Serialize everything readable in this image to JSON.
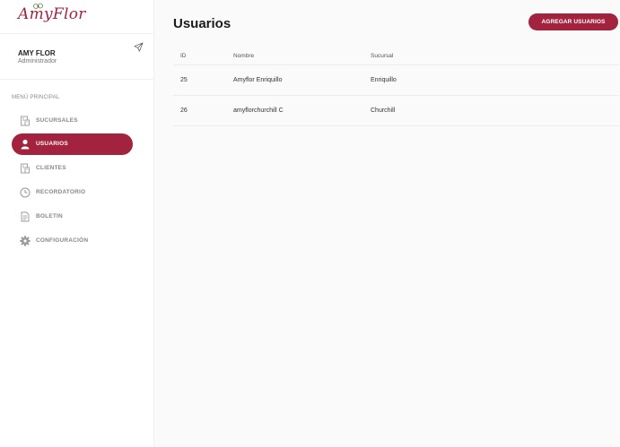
{
  "app": {
    "logo_text": "AmyFlor"
  },
  "user": {
    "name": "AMY FLOR",
    "role": "Administrador"
  },
  "sidebar": {
    "heading": "MENÚ PRINCIPAL",
    "items": [
      {
        "label": "SUCURSALES",
        "icon": "building-icon",
        "active": false
      },
      {
        "label": "USUARIOS",
        "icon": "user-icon",
        "active": true
      },
      {
        "label": "CLIENTES",
        "icon": "building-icon",
        "active": false
      },
      {
        "label": "RECORDATORIO",
        "icon": "clock-icon",
        "active": false
      },
      {
        "label": "BOLETIN",
        "icon": "document-icon",
        "active": false
      },
      {
        "label": "CONFIGURACIÓN",
        "icon": "gear-icon",
        "active": false
      }
    ]
  },
  "main": {
    "title": "Usuarios",
    "add_button_label": "AGREGAR USUARIOS",
    "table": {
      "headers": {
        "id": "ID",
        "name": "Nombre",
        "branch": "Sucursal"
      },
      "rows": [
        {
          "id": "25",
          "name": "Amyflor Enriquillo",
          "branch": "Enriquillo"
        },
        {
          "id": "26",
          "name": "amyflorchurchill C",
          "branch": "Churchill"
        }
      ]
    }
  },
  "colors": {
    "accent": "#a3233f",
    "background": "#fafafa",
    "sidebar": "#ffffff"
  }
}
